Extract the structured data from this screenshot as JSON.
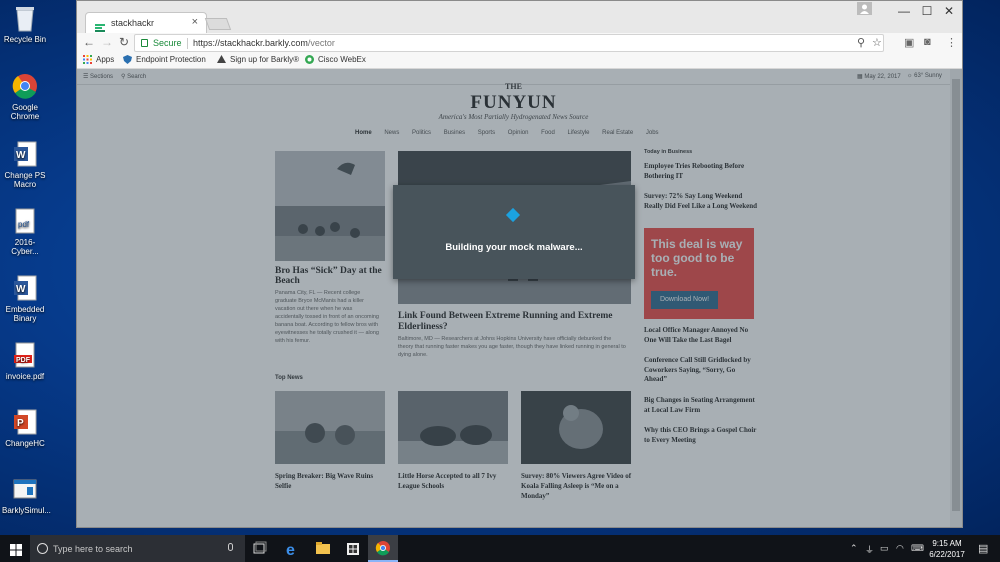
{
  "desktop": {
    "icons": [
      {
        "label": "Recycle Bin",
        "icon": "recycle-bin-icon"
      },
      {
        "label": "Google Chrome",
        "icon": "chrome-icon"
      },
      {
        "label": "Change PS Macro",
        "icon": "word-doc-icon"
      },
      {
        "label": "2016-Cyber...",
        "icon": "pdf-file-icon"
      },
      {
        "label": "Embedded Binary",
        "icon": "word-doc-icon"
      },
      {
        "label": "invoice.pdf",
        "icon": "pdf-file-icon"
      },
      {
        "label": "ChangeHC",
        "icon": "powerpoint-icon"
      },
      {
        "label": "BarklySimul...",
        "icon": "app-window-icon"
      }
    ]
  },
  "browser": {
    "tab_title": "stackhackr",
    "address": {
      "secure_label": "Secure",
      "url_main": "https://stackhackr.barkly.com",
      "url_path": "/vector"
    },
    "bookmarks": [
      {
        "label": "Apps",
        "icon": "apps-grid-icon"
      },
      {
        "label": "Endpoint Protection",
        "icon": "shield-icon"
      },
      {
        "label": "Sign up for Barkly®",
        "icon": "barkly-icon"
      },
      {
        "label": "Cisco WebEx",
        "icon": "webex-icon"
      }
    ]
  },
  "site": {
    "top_bar": {
      "sections": "Sections",
      "search": "Search",
      "date": "May 22, 2017",
      "weather": "63° Sunny"
    },
    "masthead_the": "THE",
    "masthead": "FUNYUN",
    "tagline": "America's Most Partially Hydrogenated News Source",
    "nav": [
      "Home",
      "News",
      "Politics",
      "Busines",
      "Sports",
      "Opinion",
      "Food",
      "Lifestyle",
      "Real Estate",
      "Jobs"
    ],
    "lead_left": {
      "headline": "Bro Has “Sick” Day at the Beach",
      "excerpt": "Panama City, FL — Recent college graduate Bryce McManis had a killer vacation out there when he was accidentally tossed in front of an oncoming banana boat. According to fellow bros with eyewitnesses he totally crushed it — along with his femur."
    },
    "lead_center": {
      "headline": "Link Found Between Extreme Running and Extreme Elderliness?",
      "excerpt": "Baltimore, MD — Researchers at Johns Hopkins University have officially debunked the theory that running faster makes you age faster, though they have linked running in general to dying alone."
    },
    "top_news_label": "Top News",
    "top_news": [
      "Spring Breaker: Big Wave Ruins Selfie",
      "Little Horse Accepted to all 7 Ivy League Schools",
      "Survey: 80% Viewers Agree Video of Koala Falling Asleep is “Me on a Monday”"
    ],
    "sidebar": {
      "label": "Today in Business",
      "links_top": [
        "Employee Tries Rebooting Before Bothering IT",
        "Survey: 72% Say Long Weekend Really Did Feel Like a Long Weekend"
      ],
      "ad_text": "This deal is way too good to be true.",
      "ad_button": "Download Now!",
      "links_bottom": [
        "Local Office Manager Annoyed No One Will Take the Last Bagel",
        "Conference Call Still Gridlocked by Coworkers Saying, “Sorry, Go Ahead”",
        "Big Changes in Seating Arrangement at Local Law Firm",
        "Why this CEO Brings a Gospel Choir to Every Meeting"
      ]
    }
  },
  "modal": {
    "message": "Building your mock malware..."
  },
  "taskbar": {
    "search_placeholder": "Type here to search",
    "time": "9:15 AM",
    "date": "6/22/2017"
  },
  "colors": {
    "ad_red": "#ec3b38",
    "ad_button": "#1d5d86",
    "spinner": "#1ba2e0",
    "overlay": "#46565f",
    "secure_green": "#1a8a3a"
  }
}
